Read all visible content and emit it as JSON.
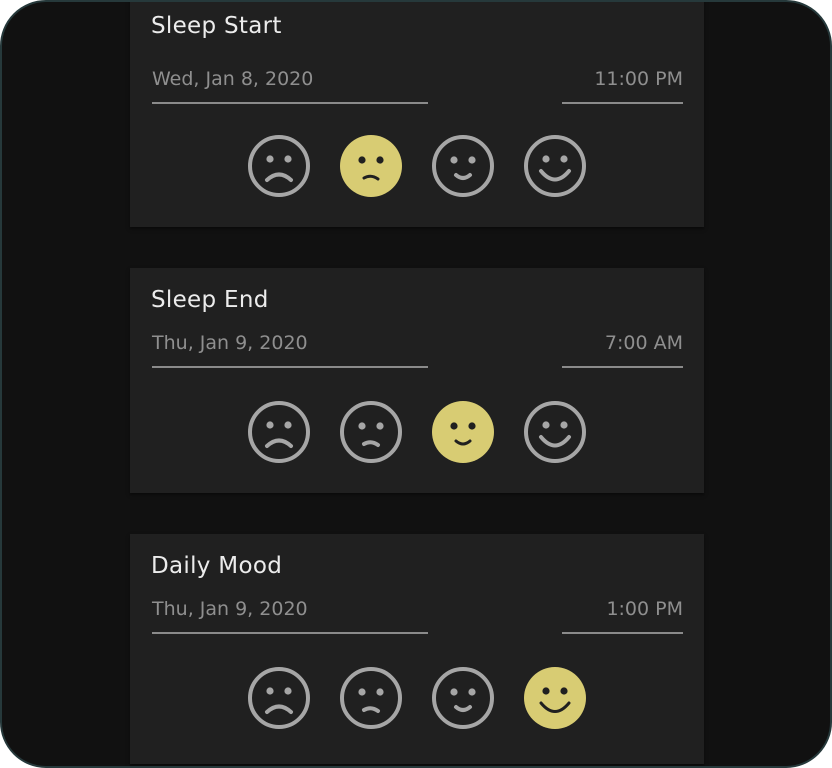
{
  "colors": {
    "selected_fill": "#d8cc73",
    "unselected_stroke": "#a6a6a6",
    "card_bg": "#202020",
    "screen_bg": "#111111"
  },
  "cards": [
    {
      "title": "Sleep Start",
      "date": "Wed, Jan 8, 2020",
      "time": "11:00 PM",
      "selected_mood": 1
    },
    {
      "title": "Sleep End",
      "date": "Thu, Jan 9, 2020",
      "time": "7:00 AM",
      "selected_mood": 2
    },
    {
      "title": "Daily Mood",
      "date": "Thu, Jan 9, 2020",
      "time": "1:00 PM",
      "selected_mood": 3
    }
  ],
  "moods": [
    "very-sad-face-icon",
    "sad-face-icon",
    "neutral-smile-face-icon",
    "happy-face-icon"
  ]
}
